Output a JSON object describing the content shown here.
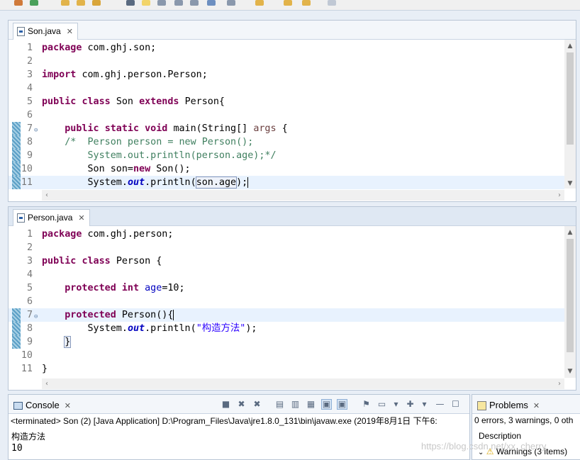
{
  "editors": [
    {
      "tab": "Son.java",
      "lines": [
        {
          "n": "1",
          "segs": [
            [
              "kw",
              "package"
            ],
            [
              "",
              "com.ghj.son;"
            ]
          ]
        },
        {
          "n": "2",
          "segs": []
        },
        {
          "n": "3",
          "segs": [
            [
              "kw",
              "import"
            ],
            [
              "",
              "com.ghj.person.Person;"
            ]
          ]
        },
        {
          "n": "4",
          "segs": []
        },
        {
          "n": "5",
          "segs": [
            [
              "kw",
              "public"
            ],
            [
              "",
              ""
            ],
            [
              "kw",
              "class"
            ],
            [
              "",
              "Son "
            ],
            [
              "kw",
              "extends"
            ],
            [
              "",
              "Person{"
            ]
          ]
        },
        {
          "n": "6",
          "segs": []
        },
        {
          "n": "7",
          "marker": true,
          "fold": true,
          "segs": [
            [
              "",
              "    "
            ],
            [
              "kw",
              "public"
            ],
            [
              "",
              ""
            ],
            [
              "kw",
              "static"
            ],
            [
              "",
              ""
            ],
            [
              "kw",
              "void"
            ],
            [
              "",
              "main(String[] "
            ],
            [
              "var",
              "args"
            ],
            [
              "",
              " {"
            ]
          ]
        },
        {
          "n": "8",
          "marker": true,
          "segs": [
            [
              "",
              "    "
            ],
            [
              "cm",
              "/*  Person person = new Person();"
            ]
          ]
        },
        {
          "n": "9",
          "marker": true,
          "segs": [
            [
              "",
              "    "
            ],
            [
              "cm",
              "    System.out.println(person.age);*/"
            ]
          ]
        },
        {
          "n": "10",
          "marker": true,
          "segs": [
            [
              "",
              "        Son son="
            ],
            [
              "kw",
              "new"
            ],
            [
              "",
              " Son();"
            ]
          ]
        },
        {
          "n": "11",
          "marker": true,
          "current": true,
          "segs": [
            [
              "",
              "        System."
            ],
            [
              "static",
              "out"
            ],
            [
              "",
              ".println("
            ],
            [
              "box",
              "son.age"
            ],
            [
              "caret",
              ");"
            ]
          ]
        }
      ]
    },
    {
      "tab": "Person.java",
      "lines": [
        {
          "n": "1",
          "segs": [
            [
              "kw",
              "package"
            ],
            [
              "",
              "com.ghj.person;"
            ]
          ]
        },
        {
          "n": "2",
          "segs": []
        },
        {
          "n": "3",
          "segs": [
            [
              "kw",
              "public"
            ],
            [
              "",
              ""
            ],
            [
              "kw",
              "class"
            ],
            [
              "",
              "Person {"
            ]
          ]
        },
        {
          "n": "4",
          "segs": []
        },
        {
          "n": "5",
          "segs": [
            [
              "",
              "    "
            ],
            [
              "kw",
              "protected"
            ],
            [
              "",
              ""
            ],
            [
              "kw",
              "int"
            ],
            [
              "",
              ""
            ],
            [
              "fld",
              "age"
            ],
            [
              "",
              "=10;"
            ]
          ]
        },
        {
          "n": "6",
          "segs": []
        },
        {
          "n": "7",
          "marker": true,
          "fold": true,
          "current": true,
          "segs": [
            [
              "",
              "    "
            ],
            [
              "kw",
              "protected"
            ],
            [
              "",
              " Person()"
            ],
            [
              "caret",
              "{"
            ]
          ]
        },
        {
          "n": "8",
          "marker": true,
          "segs": [
            [
              "",
              "        System."
            ],
            [
              "static",
              "out"
            ],
            [
              "",
              ".println("
            ],
            [
              "str",
              "\"构造方法\""
            ],
            [
              "",
              ");"
            ]
          ]
        },
        {
          "n": "9",
          "marker": true,
          "segs": [
            [
              "",
              "    "
            ],
            [
              "box",
              "}"
            ]
          ]
        },
        {
          "n": "10",
          "segs": []
        },
        {
          "n": "11",
          "segs": [
            [
              "",
              "}"
            ]
          ]
        }
      ]
    }
  ],
  "console": {
    "tab": "Console",
    "status": "<terminated> Son (2) [Java Application] D:\\Program_Files\\Java\\jre1.8.0_131\\bin\\javaw.exe (2019年8月1日 下午6:",
    "output": [
      "构造方法",
      "10"
    ]
  },
  "problems": {
    "tab": "Problems",
    "summary": "0 errors, 3 warnings, 0 oth",
    "column_header": "Description",
    "warnings_row": "Warnings (3 items)"
  },
  "watermark": "https://blog.csdn.net/xx_cherry"
}
